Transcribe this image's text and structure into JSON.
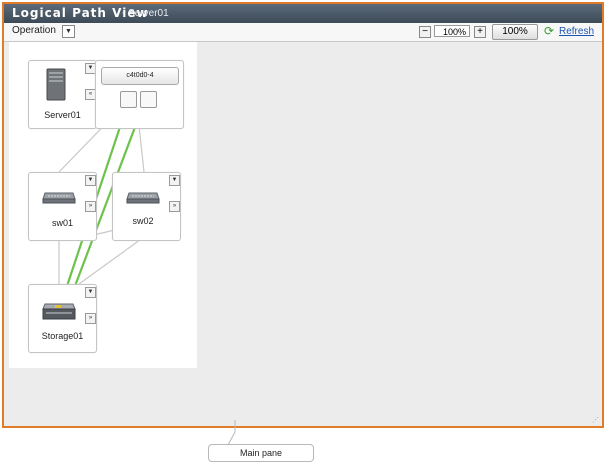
{
  "window": {
    "title": "Logical Path View",
    "subtitle": "- Server01"
  },
  "toolbar": {
    "operation_label": "Operation",
    "zoom_value": "100%",
    "zoom_reset_label": "100%",
    "refresh_label": "Refresh"
  },
  "nodes": {
    "server": {
      "name": "Server01",
      "hba": "c4t0d0-4"
    },
    "switch1": {
      "name": "sw01"
    },
    "switch2": {
      "name": "sw02"
    },
    "storage": {
      "name": "Storage01"
    }
  },
  "callout": {
    "label": "Main pane"
  },
  "colors": {
    "frame_border": "#e07b2a",
    "path_green": "#6cc24a",
    "title_bar": "#3d4a57",
    "link": "#1d56b0"
  },
  "icons": [
    "chevron-down-icon",
    "minus-icon",
    "plus-icon",
    "refresh-icon",
    "collapse-left-icon",
    "expand-right-icon",
    "server-icon",
    "switch-icon",
    "storage-icon"
  ]
}
